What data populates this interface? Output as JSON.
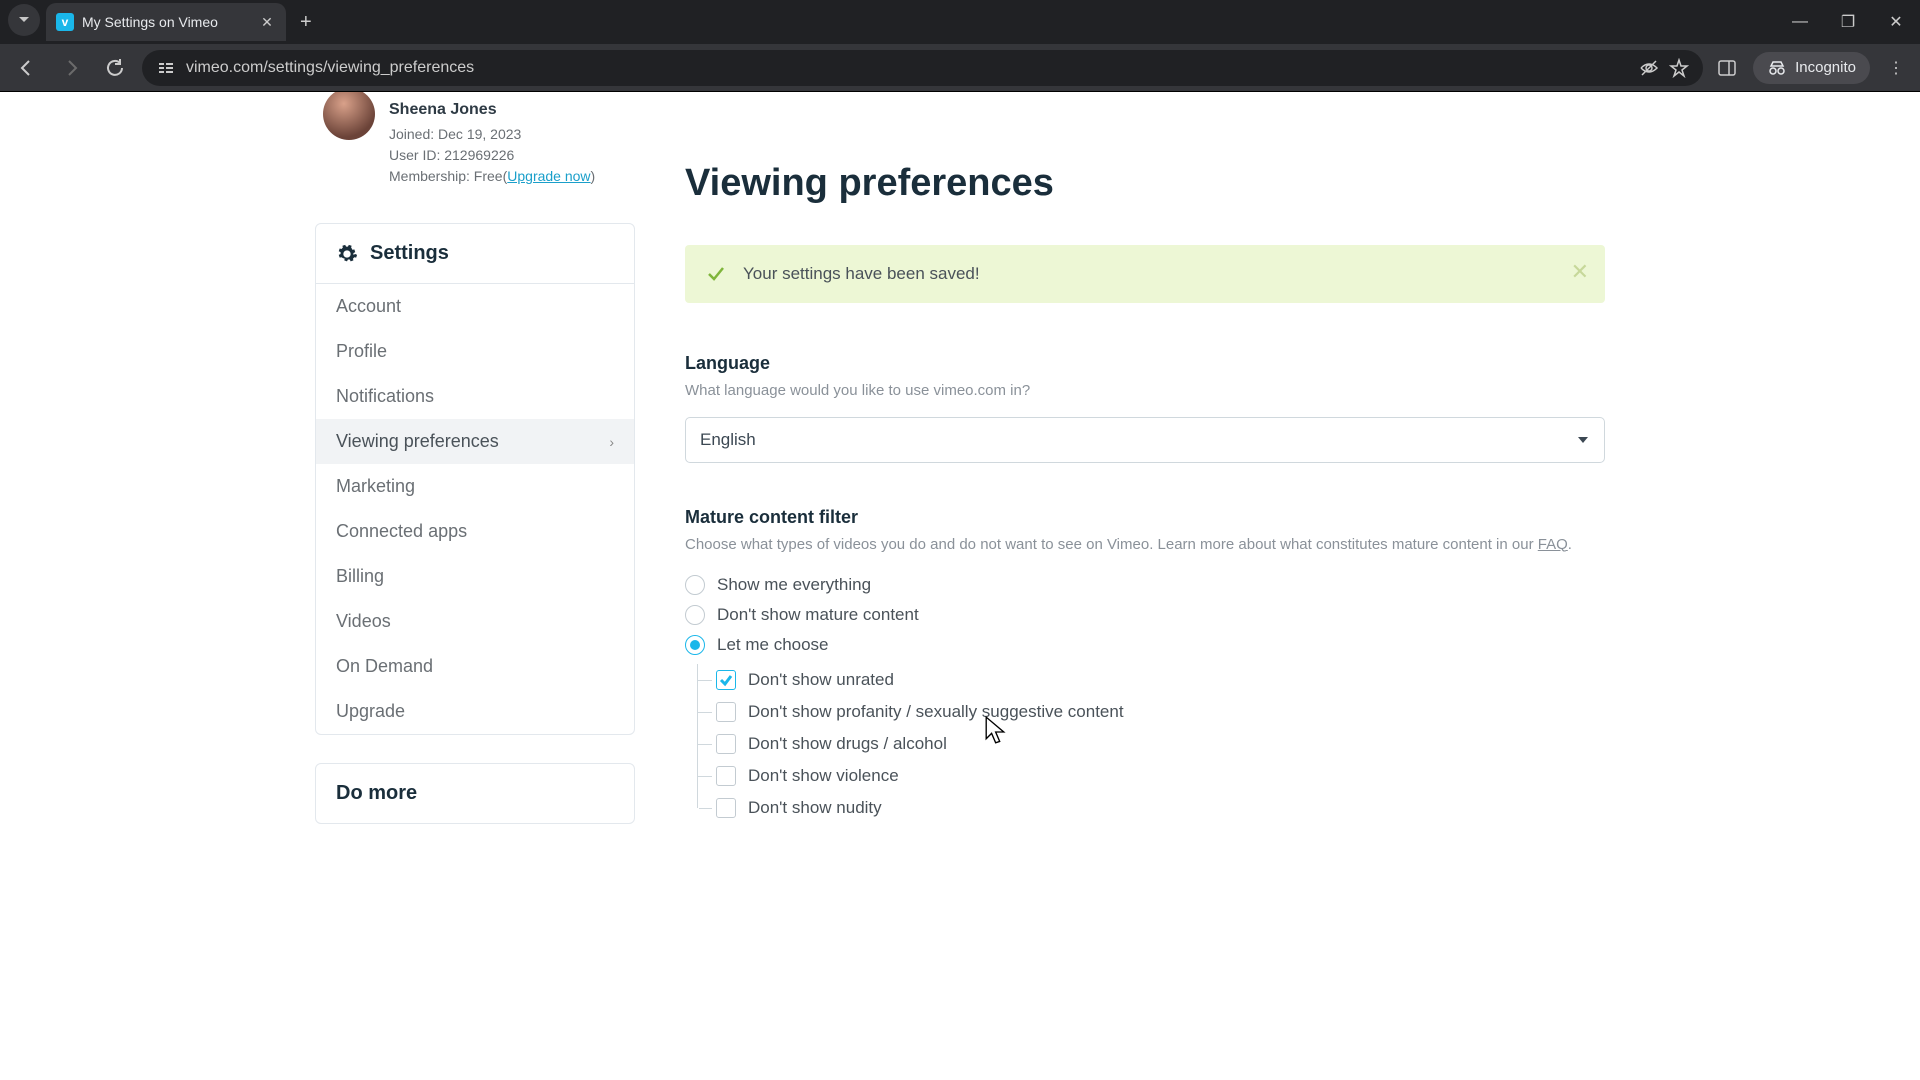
{
  "browser": {
    "tab_title": "My Settings on Vimeo",
    "url": "vimeo.com/settings/viewing_preferences",
    "incognito_label": "Incognito"
  },
  "profile": {
    "name": "Sheena Jones",
    "joined": "Joined: Dec 19, 2023",
    "user_id": "User ID: 212969226",
    "membership_prefix": "Membership: Free(",
    "upgrade": "Upgrade now",
    "membership_suffix": ")"
  },
  "sidebar": {
    "settings_title": "Settings",
    "items": [
      "Account",
      "Profile",
      "Notifications",
      "Viewing preferences",
      "Marketing",
      "Connected apps",
      "Billing",
      "Videos",
      "On Demand",
      "Upgrade"
    ],
    "active_index": 3,
    "do_more_title": "Do more"
  },
  "main": {
    "title": "Viewing preferences",
    "banner": "Your settings have been saved!",
    "language": {
      "title": "Language",
      "desc": "What language would you like to use vimeo.com in?",
      "value": "English"
    },
    "mature": {
      "title": "Mature content filter",
      "desc_prefix": "Choose what types of videos you do and do not want to see on Vimeo. Learn more about what constitutes mature content in our ",
      "faq": "FAQ",
      "desc_suffix": ".",
      "radios": [
        "Show me everything",
        "Don't show mature content",
        "Let me choose"
      ],
      "radio_selected": 2,
      "checkboxes": [
        {
          "label": "Don't show unrated",
          "checked": true
        },
        {
          "label": "Don't show profanity / sexually suggestive content",
          "checked": false
        },
        {
          "label": "Don't show drugs / alcohol",
          "checked": false
        },
        {
          "label": "Don't show violence",
          "checked": false
        },
        {
          "label": "Don't show nudity",
          "checked": false
        }
      ]
    }
  }
}
